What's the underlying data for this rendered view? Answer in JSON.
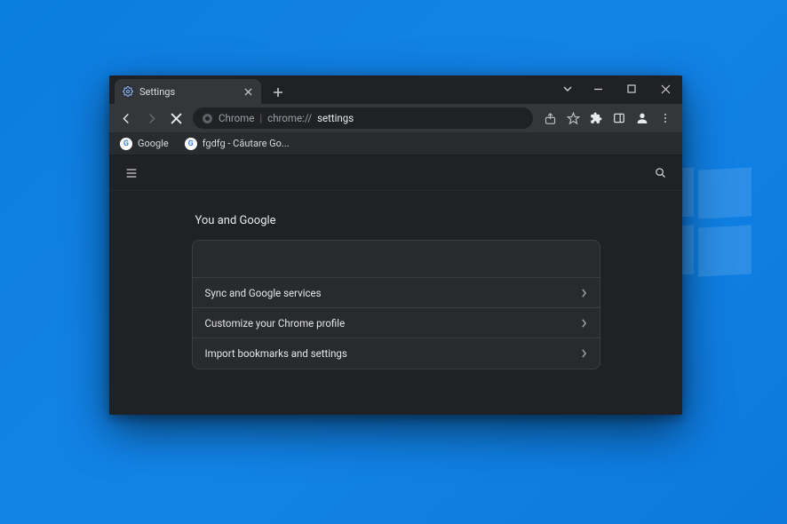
{
  "tab": {
    "title": "Settings"
  },
  "window_controls": {
    "dropdown": "⌄",
    "min": "—",
    "max": "▢",
    "close": "✕"
  },
  "toolbar": {
    "omnibox_chip": "Chrome",
    "url_prefix": "chrome://",
    "url_main": "settings"
  },
  "bookmarks": [
    {
      "label": "Google"
    },
    {
      "label": "fgdfg - Căutare Go..."
    }
  ],
  "settings": {
    "section_title": "You and Google",
    "rows": [
      {
        "label": "Sync and Google services"
      },
      {
        "label": "Customize your Chrome profile"
      },
      {
        "label": "Import bookmarks and settings"
      }
    ]
  }
}
